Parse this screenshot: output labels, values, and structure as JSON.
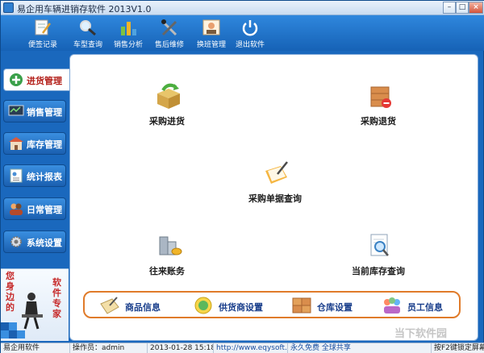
{
  "window": {
    "title": "易企用车辆进销存软件 2013V1.0",
    "controls": [
      "–",
      "□",
      "×"
    ]
  },
  "toolbar": [
    {
      "label": "便签记录",
      "icon": "note-pencil-icon",
      "color": "#f3f3f3"
    },
    {
      "label": "车型查询",
      "icon": "magnifier-icon",
      "color": "#dfe7ef"
    },
    {
      "label": "销售分析",
      "icon": "bar-chart-icon",
      "color": "#8bc34a"
    },
    {
      "label": "售后维修",
      "icon": "tools-icon",
      "color": "#cfd8dc"
    },
    {
      "label": "换班管理",
      "icon": "person-card-icon",
      "color": "#ffe0b2"
    },
    {
      "label": "退出软件",
      "icon": "power-icon",
      "color": "#ffffff"
    }
  ],
  "sidebar": {
    "items": [
      {
        "label": "进货管理",
        "icon": "plus-circle-icon",
        "active": true
      },
      {
        "label": "销售管理",
        "icon": "monitor-icon",
        "active": false
      },
      {
        "label": "库存管理",
        "icon": "warehouse-icon",
        "active": false
      },
      {
        "label": "统计报表",
        "icon": "report-icon",
        "active": false
      },
      {
        "label": "日常管理",
        "icon": "people-icon",
        "active": false
      },
      {
        "label": "系统设置",
        "icon": "gear-icon",
        "active": false
      }
    ],
    "slogan_left": "您身边的",
    "slogan_right": "软件专家"
  },
  "functions": [
    {
      "label": "采购进货",
      "icon": "purchase-box-icon"
    },
    {
      "label": "采购退货",
      "icon": "return-box-icon"
    },
    {
      "label": "采购单据查询",
      "icon": "document-query-icon"
    },
    {
      "label": "往来账务",
      "icon": "coins-icon"
    },
    {
      "label": "当前库存查询",
      "icon": "inventory-search-icon"
    }
  ],
  "quick_links": [
    {
      "label": "商品信息",
      "icon": "product-info-icon"
    },
    {
      "label": "供货商设置",
      "icon": "supplier-icon"
    },
    {
      "label": "仓库设置",
      "icon": "warehouse-box-icon"
    },
    {
      "label": "员工信息",
      "icon": "staff-icon"
    }
  ],
  "statusbar": {
    "app": "易企用软件",
    "operator": "操作员：admin",
    "datetime": "2013-01-28 15:18:13",
    "url": "http://www.eqysoft.com/",
    "promo": "永久免费 全球共享",
    "hint": "按F2键锁定屏幕"
  },
  "watermark": "当下软件园",
  "colors": {
    "accent_blue": "#1a68bd",
    "active_label_red": "#b3201a",
    "quickbar_border": "#e07b2a"
  }
}
